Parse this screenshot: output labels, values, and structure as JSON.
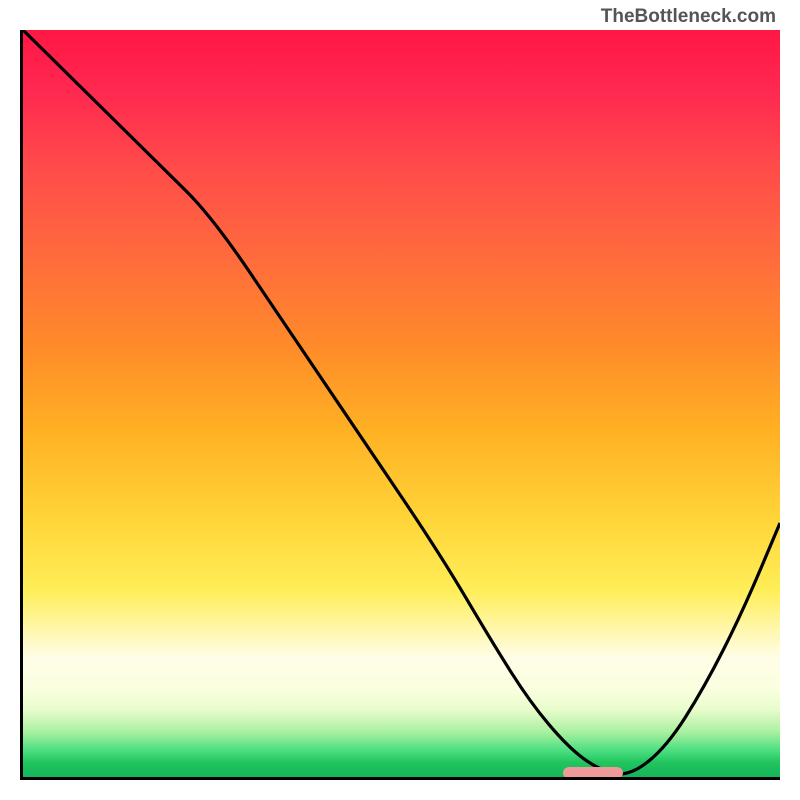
{
  "watermark": "TheBottleneck.com",
  "chart_data": {
    "type": "line",
    "title": "",
    "xlabel": "",
    "ylabel": "",
    "xlim": [
      0,
      100
    ],
    "ylim": [
      0,
      100
    ],
    "grid": false,
    "series": [
      {
        "name": "curve",
        "x": [
          0,
          8,
          18,
          25,
          35,
          45,
          55,
          62,
          67,
          72,
          76,
          80,
          85,
          90,
          95,
          100
        ],
        "values": [
          100,
          92,
          82,
          75,
          60,
          45,
          30,
          18,
          10,
          4,
          1,
          0,
          4,
          12,
          22,
          34
        ]
      }
    ],
    "marker": {
      "x_start": 71,
      "x_end": 79,
      "y": 1
    },
    "gradient_colors": {
      "top": "#ff1744",
      "mid": "#ffd63a",
      "bottom": "#15b45a"
    }
  }
}
